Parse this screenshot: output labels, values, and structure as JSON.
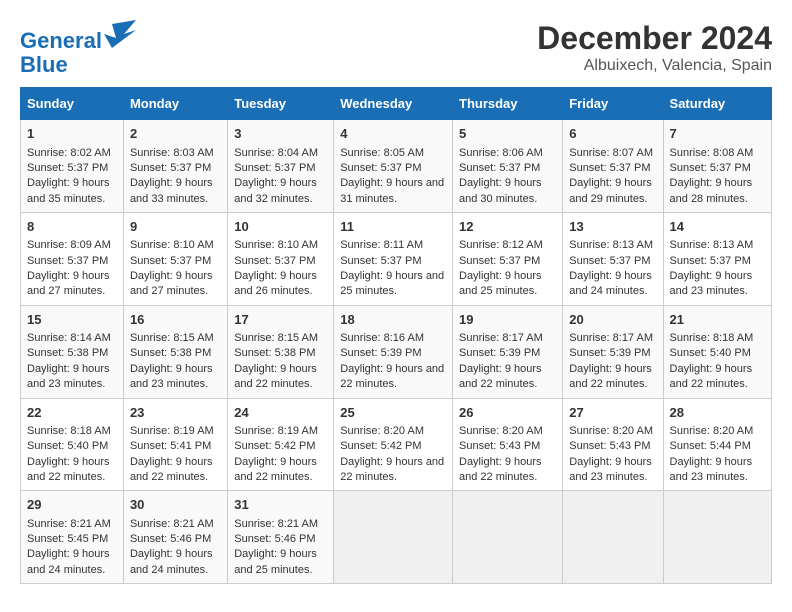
{
  "header": {
    "logo_line1": "General",
    "logo_line2": "Blue",
    "title": "December 2024",
    "subtitle": "Albuixech, Valencia, Spain"
  },
  "weekdays": [
    "Sunday",
    "Monday",
    "Tuesday",
    "Wednesday",
    "Thursday",
    "Friday",
    "Saturday"
  ],
  "weeks": [
    [
      {
        "day": "1",
        "sunrise": "Sunrise: 8:02 AM",
        "sunset": "Sunset: 5:37 PM",
        "daylight": "Daylight: 9 hours and 35 minutes."
      },
      {
        "day": "2",
        "sunrise": "Sunrise: 8:03 AM",
        "sunset": "Sunset: 5:37 PM",
        "daylight": "Daylight: 9 hours and 33 minutes."
      },
      {
        "day": "3",
        "sunrise": "Sunrise: 8:04 AM",
        "sunset": "Sunset: 5:37 PM",
        "daylight": "Daylight: 9 hours and 32 minutes."
      },
      {
        "day": "4",
        "sunrise": "Sunrise: 8:05 AM",
        "sunset": "Sunset: 5:37 PM",
        "daylight": "Daylight: 9 hours and 31 minutes."
      },
      {
        "day": "5",
        "sunrise": "Sunrise: 8:06 AM",
        "sunset": "Sunset: 5:37 PM",
        "daylight": "Daylight: 9 hours and 30 minutes."
      },
      {
        "day": "6",
        "sunrise": "Sunrise: 8:07 AM",
        "sunset": "Sunset: 5:37 PM",
        "daylight": "Daylight: 9 hours and 29 minutes."
      },
      {
        "day": "7",
        "sunrise": "Sunrise: 8:08 AM",
        "sunset": "Sunset: 5:37 PM",
        "daylight": "Daylight: 9 hours and 28 minutes."
      }
    ],
    [
      {
        "day": "8",
        "sunrise": "Sunrise: 8:09 AM",
        "sunset": "Sunset: 5:37 PM",
        "daylight": "Daylight: 9 hours and 27 minutes."
      },
      {
        "day": "9",
        "sunrise": "Sunrise: 8:10 AM",
        "sunset": "Sunset: 5:37 PM",
        "daylight": "Daylight: 9 hours and 27 minutes."
      },
      {
        "day": "10",
        "sunrise": "Sunrise: 8:10 AM",
        "sunset": "Sunset: 5:37 PM",
        "daylight": "Daylight: 9 hours and 26 minutes."
      },
      {
        "day": "11",
        "sunrise": "Sunrise: 8:11 AM",
        "sunset": "Sunset: 5:37 PM",
        "daylight": "Daylight: 9 hours and 25 minutes."
      },
      {
        "day": "12",
        "sunrise": "Sunrise: 8:12 AM",
        "sunset": "Sunset: 5:37 PM",
        "daylight": "Daylight: 9 hours and 25 minutes."
      },
      {
        "day": "13",
        "sunrise": "Sunrise: 8:13 AM",
        "sunset": "Sunset: 5:37 PM",
        "daylight": "Daylight: 9 hours and 24 minutes."
      },
      {
        "day": "14",
        "sunrise": "Sunrise: 8:13 AM",
        "sunset": "Sunset: 5:37 PM",
        "daylight": "Daylight: 9 hours and 23 minutes."
      }
    ],
    [
      {
        "day": "15",
        "sunrise": "Sunrise: 8:14 AM",
        "sunset": "Sunset: 5:38 PM",
        "daylight": "Daylight: 9 hours and 23 minutes."
      },
      {
        "day": "16",
        "sunrise": "Sunrise: 8:15 AM",
        "sunset": "Sunset: 5:38 PM",
        "daylight": "Daylight: 9 hours and 23 minutes."
      },
      {
        "day": "17",
        "sunrise": "Sunrise: 8:15 AM",
        "sunset": "Sunset: 5:38 PM",
        "daylight": "Daylight: 9 hours and 22 minutes."
      },
      {
        "day": "18",
        "sunrise": "Sunrise: 8:16 AM",
        "sunset": "Sunset: 5:39 PM",
        "daylight": "Daylight: 9 hours and 22 minutes."
      },
      {
        "day": "19",
        "sunrise": "Sunrise: 8:17 AM",
        "sunset": "Sunset: 5:39 PM",
        "daylight": "Daylight: 9 hours and 22 minutes."
      },
      {
        "day": "20",
        "sunrise": "Sunrise: 8:17 AM",
        "sunset": "Sunset: 5:39 PM",
        "daylight": "Daylight: 9 hours and 22 minutes."
      },
      {
        "day": "21",
        "sunrise": "Sunrise: 8:18 AM",
        "sunset": "Sunset: 5:40 PM",
        "daylight": "Daylight: 9 hours and 22 minutes."
      }
    ],
    [
      {
        "day": "22",
        "sunrise": "Sunrise: 8:18 AM",
        "sunset": "Sunset: 5:40 PM",
        "daylight": "Daylight: 9 hours and 22 minutes."
      },
      {
        "day": "23",
        "sunrise": "Sunrise: 8:19 AM",
        "sunset": "Sunset: 5:41 PM",
        "daylight": "Daylight: 9 hours and 22 minutes."
      },
      {
        "day": "24",
        "sunrise": "Sunrise: 8:19 AM",
        "sunset": "Sunset: 5:42 PM",
        "daylight": "Daylight: 9 hours and 22 minutes."
      },
      {
        "day": "25",
        "sunrise": "Sunrise: 8:20 AM",
        "sunset": "Sunset: 5:42 PM",
        "daylight": "Daylight: 9 hours and 22 minutes."
      },
      {
        "day": "26",
        "sunrise": "Sunrise: 8:20 AM",
        "sunset": "Sunset: 5:43 PM",
        "daylight": "Daylight: 9 hours and 22 minutes."
      },
      {
        "day": "27",
        "sunrise": "Sunrise: 8:20 AM",
        "sunset": "Sunset: 5:43 PM",
        "daylight": "Daylight: 9 hours and 23 minutes."
      },
      {
        "day": "28",
        "sunrise": "Sunrise: 8:20 AM",
        "sunset": "Sunset: 5:44 PM",
        "daylight": "Daylight: 9 hours and 23 minutes."
      }
    ],
    [
      {
        "day": "29",
        "sunrise": "Sunrise: 8:21 AM",
        "sunset": "Sunset: 5:45 PM",
        "daylight": "Daylight: 9 hours and 24 minutes."
      },
      {
        "day": "30",
        "sunrise": "Sunrise: 8:21 AM",
        "sunset": "Sunset: 5:46 PM",
        "daylight": "Daylight: 9 hours and 24 minutes."
      },
      {
        "day": "31",
        "sunrise": "Sunrise: 8:21 AM",
        "sunset": "Sunset: 5:46 PM",
        "daylight": "Daylight: 9 hours and 25 minutes."
      },
      null,
      null,
      null,
      null
    ]
  ]
}
